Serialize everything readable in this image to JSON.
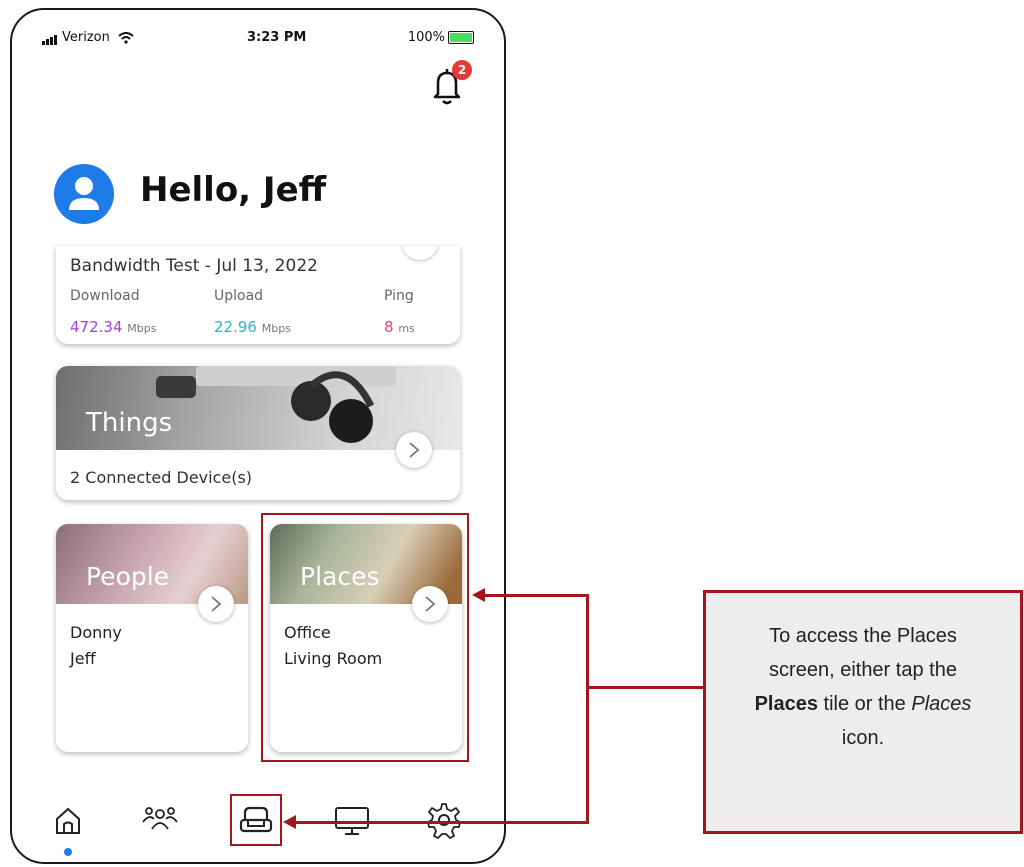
{
  "status_bar": {
    "carrier": "Verizon",
    "time": "3:23 PM",
    "battery": "100%"
  },
  "notifications": {
    "count": "2"
  },
  "greeting": "Hello, Jeff",
  "bandwidth": {
    "title": "Bandwidth Test - Jul 13, 2022",
    "download_label": "Download",
    "upload_label": "Upload",
    "ping_label": "Ping",
    "download_value": "472.34",
    "download_unit": "Mbps",
    "upload_value": "22.96",
    "upload_unit": "Mbps",
    "ping_value": "8",
    "ping_unit": "ms"
  },
  "things": {
    "label": "Things",
    "subtitle": "2 Connected Device(s)"
  },
  "people": {
    "label": "People",
    "items": [
      "Donny",
      "Jeff"
    ]
  },
  "places": {
    "label": "Places",
    "items": [
      "Office",
      "Living Room"
    ]
  },
  "callout": {
    "line1": "To access the Places",
    "line2": "screen, either tap the",
    "bold": "Places",
    "mid": " tile or the ",
    "italic": "Places",
    "end": "icon."
  },
  "colors": {
    "download": "#a740d6",
    "upload": "#2fb3c6",
    "ping": "#e8437a",
    "accent": "#1e7be8",
    "annotation": "#a3171c"
  },
  "icons": [
    "wifi-icon",
    "bell-icon",
    "user-icon",
    "chevron-right-icon",
    "home-icon",
    "people-icon",
    "places-icon",
    "devices-icon",
    "settings-icon"
  ]
}
